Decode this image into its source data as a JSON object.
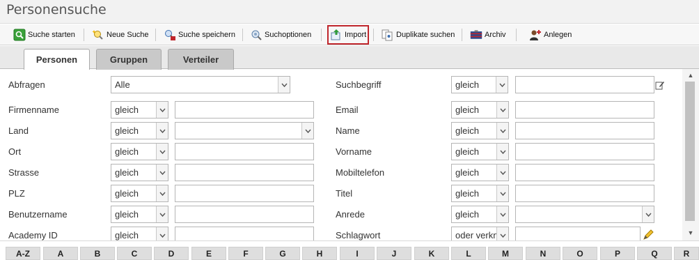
{
  "page": {
    "title": "Personensuche"
  },
  "toolbar": {
    "items": [
      {
        "label": "Suche starten",
        "icon": "search-start-icon"
      },
      {
        "label": "Neue Suche",
        "icon": "new-search-icon"
      },
      {
        "label": "Suche speichern",
        "icon": "save-search-icon"
      },
      {
        "label": "Suchoptionen",
        "icon": "search-options-icon"
      },
      {
        "label": "Import",
        "icon": "import-icon"
      },
      {
        "label": "Duplikate suchen",
        "icon": "duplicates-icon"
      },
      {
        "label": "Archiv",
        "icon": "archive-icon"
      },
      {
        "label": "Anlegen",
        "icon": "create-person-icon"
      }
    ]
  },
  "tabs": [
    {
      "label": "Personen",
      "active": true
    },
    {
      "label": "Gruppen",
      "active": false
    },
    {
      "label": "Verteiler",
      "active": false
    }
  ],
  "form": {
    "abfragen": {
      "label": "Abfragen",
      "value": "Alle"
    },
    "suchbegriff": {
      "label": "Suchbegriff",
      "operator": "gleich",
      "value": ""
    },
    "left_fields": [
      {
        "label": "Firmenname",
        "operator": "gleich",
        "value": ""
      },
      {
        "label": "Land",
        "operator": "gleich",
        "value": ""
      },
      {
        "label": "Ort",
        "operator": "gleich",
        "value": ""
      },
      {
        "label": "Strasse",
        "operator": "gleich",
        "value": ""
      },
      {
        "label": "PLZ",
        "operator": "gleich",
        "value": ""
      },
      {
        "label": "Benutzername",
        "operator": "gleich",
        "value": ""
      },
      {
        "label": "Academy ID",
        "operator": "gleich",
        "value": ""
      }
    ],
    "right_fields": [
      {
        "label": "Email",
        "operator": "gleich",
        "value": ""
      },
      {
        "label": "Name",
        "operator": "gleich",
        "value": ""
      },
      {
        "label": "Vorname",
        "operator": "gleich",
        "value": ""
      },
      {
        "label": "Mobiltelefon",
        "operator": "gleich",
        "value": ""
      },
      {
        "label": "Titel",
        "operator": "gleich",
        "value": ""
      },
      {
        "label": "Anrede",
        "operator": "gleich",
        "value": ""
      },
      {
        "label": "Schlagwort",
        "operator": "oder verkn",
        "value": ""
      }
    ]
  },
  "alphabet": [
    "A-Z",
    "A",
    "B",
    "C",
    "D",
    "E",
    "F",
    "G",
    "H",
    "I",
    "J",
    "K",
    "L",
    "M",
    "N",
    "O",
    "P",
    "Q",
    "R"
  ],
  "colors": {
    "highlight_border": "#c0262c",
    "tab_inactive": "#c9c9c9",
    "tab_active": "#ffffff"
  }
}
